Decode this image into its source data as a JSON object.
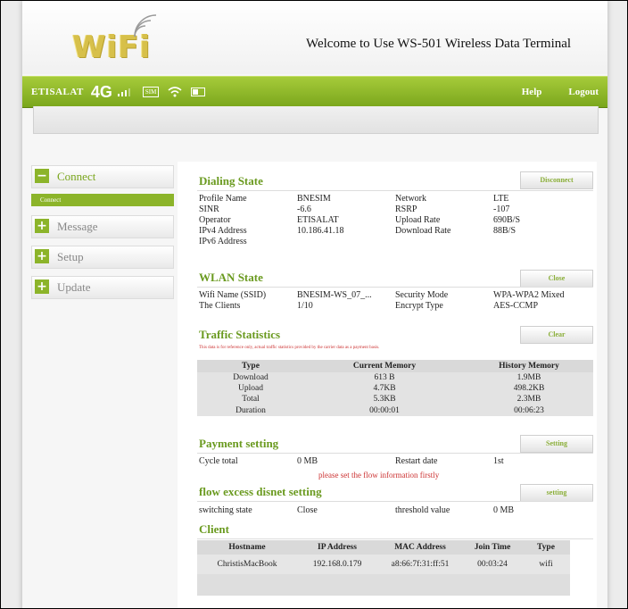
{
  "header": {
    "logo_text": "WiFi",
    "welcome": "Welcome to Use WS-501 Wireless Data Terminal"
  },
  "status_bar": {
    "carrier": "ETISALAT",
    "network": "4G",
    "sim_label": "SIM",
    "help": "Help",
    "logout": "Logout"
  },
  "sidebar": {
    "connect": {
      "sign": "−",
      "label": "Connect",
      "sub": "Connect"
    },
    "message": {
      "sign": "+",
      "label": "Message"
    },
    "setup": {
      "sign": "+",
      "label": "Setup"
    },
    "update": {
      "sign": "+",
      "label": "Update"
    }
  },
  "dialing": {
    "title": "Dialing State",
    "button": "Disconnect",
    "profile_label": "Profile Name",
    "profile_value": "BNESIM",
    "sinr_label": "SINR",
    "sinr_value": "-6.6",
    "operator_label": "Operator",
    "operator_value": "ETISALAT",
    "ipv4_label": "IPv4 Address",
    "ipv4_value": "10.186.41.18",
    "ipv6_label": "IPv6 Address",
    "network_label": "Network",
    "network_value": "LTE",
    "rsrp_label": "RSRP",
    "rsrp_value": "-107",
    "upload_label": "Upload Rate",
    "upload_value": "690B/S",
    "download_label": "Download Rate",
    "download_value": "88B/S"
  },
  "wlan": {
    "title": "WLAN State",
    "button": "Close",
    "ssid_label": "Wifi Name (SSID)",
    "ssid_value": "BNESIM-WS_07_...",
    "clients_label": "The Clients",
    "clients_value": "1/10",
    "security_label": "Security Mode",
    "security_value": "WPA-WPA2 Mixed",
    "encrypt_label": "Encrypt Type",
    "encrypt_value": "AES-CCMP"
  },
  "traffic": {
    "title": "Traffic Statistics",
    "button": "Clear",
    "note": "This data is for reference only, actual traffic statistics provided by the carrier data as a payment basis.",
    "headers": {
      "type": "Type",
      "current": "Current Memory",
      "history": "History Memory"
    },
    "rows": [
      {
        "type": "Download",
        "current": "613 B",
        "history": "1.9MB"
      },
      {
        "type": "Upload",
        "current": "4.7KB",
        "history": "498.2KB"
      },
      {
        "type": "Total",
        "current": "5.3KB",
        "history": "2.3MB"
      },
      {
        "type": "Duration",
        "current": "00:00:01",
        "history": "00:06:23"
      }
    ]
  },
  "payment": {
    "title": "Payment setting",
    "button": "Setting",
    "cycle_label": "Cycle total",
    "cycle_value": "0 MB",
    "restart_label": "Restart date",
    "restart_value": "1st",
    "warning": "please set the flow information firstly"
  },
  "flow": {
    "title": "flow excess disnet setting",
    "button": "setting",
    "switching_label": "switching state",
    "switching_value": "Close",
    "threshold_label": "threshold value",
    "threshold_value": "0 MB"
  },
  "client": {
    "title": "Client",
    "headers": {
      "hostname": "Hostname",
      "ip": "IP Address",
      "mac": "MAC Address",
      "join": "Join Time",
      "type": "Type"
    },
    "rows": [
      {
        "hostname": "ChristisMacBook",
        "ip": "192.168.0.179",
        "mac": "a8:66:7f:31:ff:51",
        "join": "00:03:24",
        "type": "wifi"
      }
    ]
  }
}
